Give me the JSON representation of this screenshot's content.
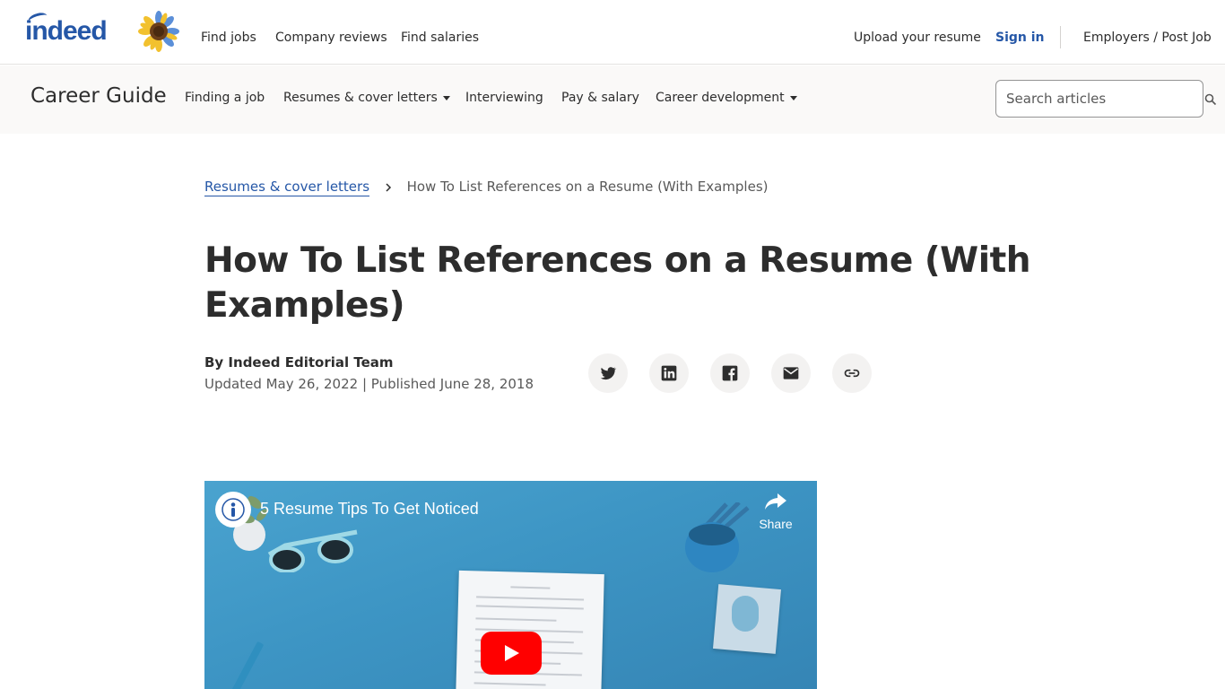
{
  "header": {
    "logo_text": "indeed",
    "nav": [
      "Find jobs",
      "Company reviews",
      "Find salaries"
    ],
    "upload_resume": "Upload your resume",
    "sign_in": "Sign in",
    "employers": "Employers / Post Job"
  },
  "career_guide": {
    "title": "Career Guide",
    "nav": [
      "Finding a job",
      "Resumes & cover letters",
      "Interviewing",
      "Pay & salary",
      "Career development"
    ],
    "search_placeholder": "Search articles"
  },
  "breadcrumb": {
    "parent": "Resumes & cover letters",
    "current": "How To List References on a Resume (With Examples)"
  },
  "article": {
    "title": "How To List References on a Resume (With Examples)",
    "author": "By Indeed Editorial Team",
    "dates": "Updated May 26, 2022 | Published June 28, 2018"
  },
  "share_icons": [
    "twitter-icon",
    "linkedin-icon",
    "facebook-icon",
    "email-icon",
    "link-icon"
  ],
  "video": {
    "title": "5 Resume Tips To Get Noticed",
    "share_label": "Share"
  },
  "colors": {
    "brand_blue": "#2557a7",
    "youtube_red": "#ff0000",
    "bar_background": "#faf9f8",
    "share_button_bg": "#f3f2f1"
  }
}
